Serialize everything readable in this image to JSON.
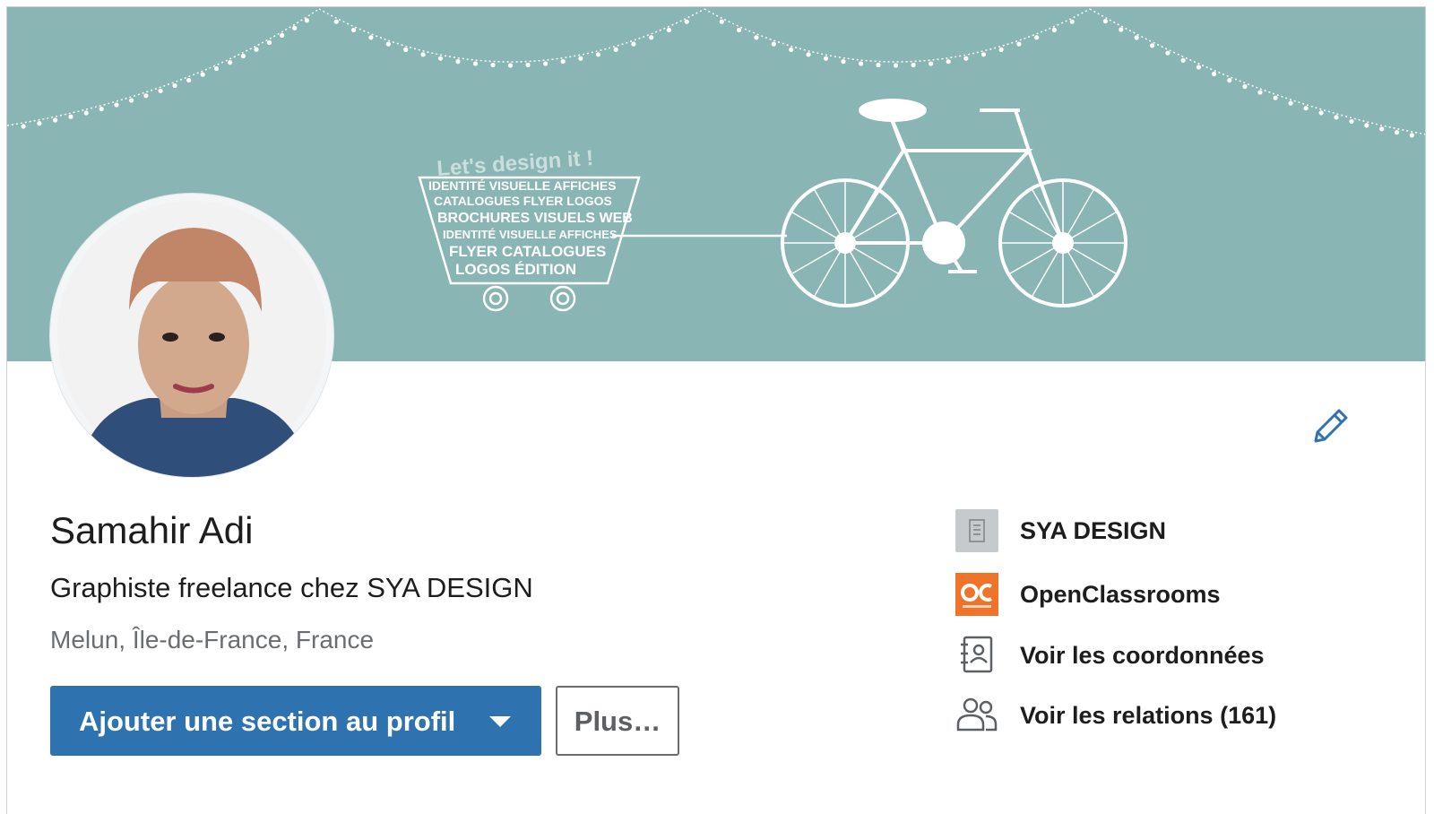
{
  "banner": {
    "tagline": "Let's design it !",
    "words": [
      "IDENTITÉ VISUELLE AFFICHES",
      "CATALOGUES  FLYER LOGOS",
      "BROCHURES  VISUELS WEB",
      "IDENTITÉ VISUELLE AFFICHES",
      "FLYER CATALOGUES",
      "LOGOS ÉDITION"
    ],
    "color": "#89b5b4"
  },
  "profile": {
    "name": "Samahir Adi",
    "headline": "Graphiste freelance chez SYA DESIGN",
    "location": "Melun, Île-de-France, France"
  },
  "actions": {
    "add_section_label": "Ajouter une section au profil",
    "more_label": "Plus…",
    "accent": "#2e72b0"
  },
  "sidebar": {
    "items": [
      {
        "icon": "company-icon",
        "label": "SYA DESIGN"
      },
      {
        "icon": "openclassrooms-logo",
        "label": "OpenClassrooms"
      },
      {
        "icon": "contact-card-icon",
        "label": "Voir les coordonnées"
      },
      {
        "icon": "people-icon",
        "label": "Voir les relations (161)"
      }
    ]
  }
}
